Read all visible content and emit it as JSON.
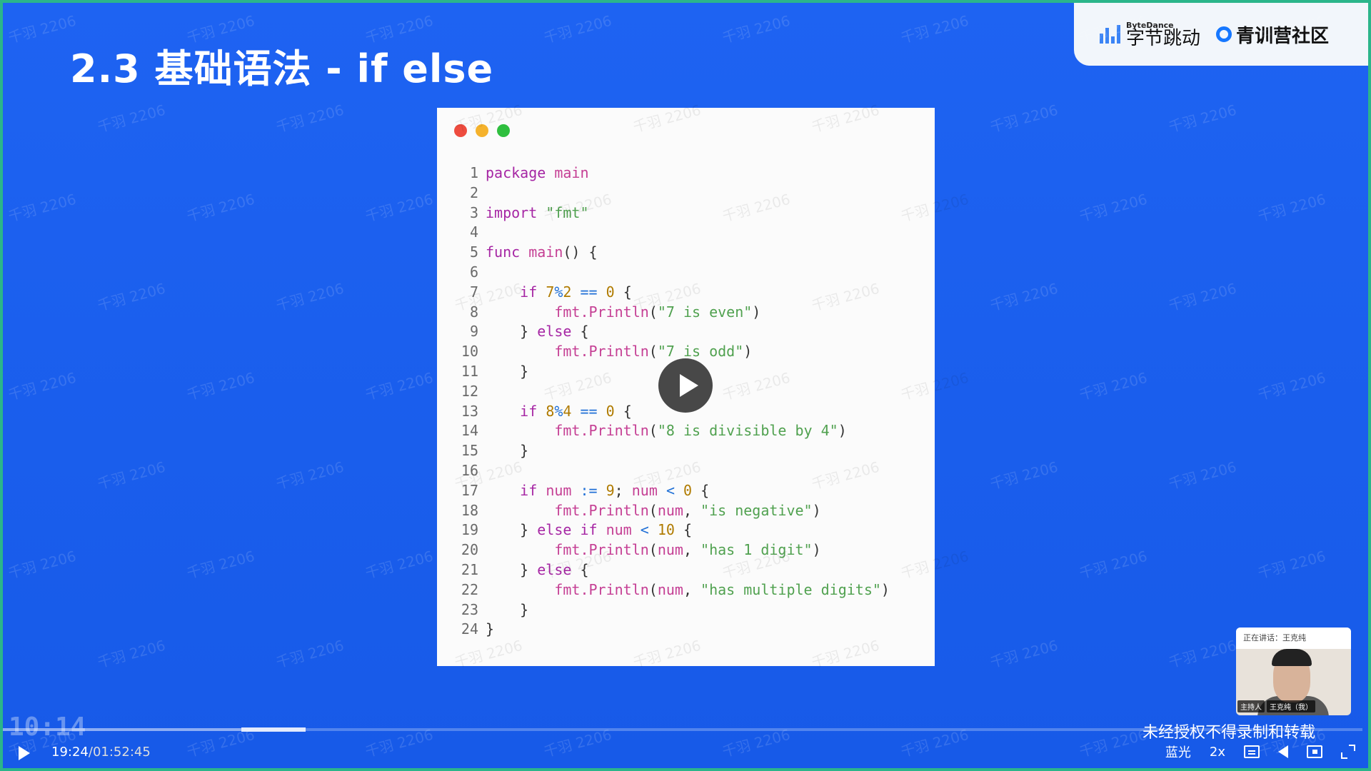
{
  "slide": {
    "title": "2.3 基础语法 - if else",
    "logo": {
      "small": "ByteDance",
      "big": "字节跳动",
      "community": "青训营社区"
    },
    "window_dots": [
      "#ee4c3f",
      "#f5b22c",
      "#2fbf3f"
    ]
  },
  "code": {
    "lines": [
      [
        [
          "kw",
          "package"
        ],
        [
          "pl",
          " "
        ],
        [
          "fn",
          "main"
        ]
      ],
      [],
      [
        [
          "kw",
          "import"
        ],
        [
          "pl",
          " "
        ],
        [
          "str",
          "\"fmt\""
        ]
      ],
      [],
      [
        [
          "kw",
          "func"
        ],
        [
          "pl",
          " "
        ],
        [
          "fn",
          "main"
        ],
        [
          "pl",
          "() {"
        ]
      ],
      [],
      [
        [
          "pl",
          "    "
        ],
        [
          "kw",
          "if"
        ],
        [
          "pl",
          " "
        ],
        [
          "num",
          "7"
        ],
        [
          "op",
          "%"
        ],
        [
          "num",
          "2"
        ],
        [
          "pl",
          " "
        ],
        [
          "op",
          "=="
        ],
        [
          "pl",
          " "
        ],
        [
          "num",
          "0"
        ],
        [
          "pl",
          " {"
        ]
      ],
      [
        [
          "pl",
          "        "
        ],
        [
          "fn",
          "fmt.Println"
        ],
        [
          "pl",
          "("
        ],
        [
          "str",
          "\"7 is even\""
        ],
        [
          "pl",
          ")"
        ]
      ],
      [
        [
          "pl",
          "    } "
        ],
        [
          "kw",
          "else"
        ],
        [
          "pl",
          " {"
        ]
      ],
      [
        [
          "pl",
          "        "
        ],
        [
          "fn",
          "fmt.Println"
        ],
        [
          "pl",
          "("
        ],
        [
          "str",
          "\"7 is odd\""
        ],
        [
          "pl",
          ")"
        ]
      ],
      [
        [
          "pl",
          "    }"
        ]
      ],
      [],
      [
        [
          "pl",
          "    "
        ],
        [
          "kw",
          "if"
        ],
        [
          "pl",
          " "
        ],
        [
          "num",
          "8"
        ],
        [
          "op",
          "%"
        ],
        [
          "num",
          "4"
        ],
        [
          "pl",
          " "
        ],
        [
          "op",
          "=="
        ],
        [
          "pl",
          " "
        ],
        [
          "num",
          "0"
        ],
        [
          "pl",
          " {"
        ]
      ],
      [
        [
          "pl",
          "        "
        ],
        [
          "fn",
          "fmt.Println"
        ],
        [
          "pl",
          "("
        ],
        [
          "str",
          "\"8 is divisible by 4\""
        ],
        [
          "pl",
          ")"
        ]
      ],
      [
        [
          "pl",
          "    }"
        ]
      ],
      [],
      [
        [
          "pl",
          "    "
        ],
        [
          "kw",
          "if"
        ],
        [
          "pl",
          " "
        ],
        [
          "fn",
          "num"
        ],
        [
          "pl",
          " "
        ],
        [
          "op",
          ":="
        ],
        [
          "pl",
          " "
        ],
        [
          "num",
          "9"
        ],
        [
          "pl",
          "; "
        ],
        [
          "fn",
          "num"
        ],
        [
          "pl",
          " "
        ],
        [
          "op",
          "<"
        ],
        [
          "pl",
          " "
        ],
        [
          "num",
          "0"
        ],
        [
          "pl",
          " {"
        ]
      ],
      [
        [
          "pl",
          "        "
        ],
        [
          "fn",
          "fmt.Println"
        ],
        [
          "pl",
          "("
        ],
        [
          "fn",
          "num"
        ],
        [
          "pl",
          ", "
        ],
        [
          "str",
          "\"is negative\""
        ],
        [
          "pl",
          ")"
        ]
      ],
      [
        [
          "pl",
          "    } "
        ],
        [
          "kw",
          "else if"
        ],
        [
          "pl",
          " "
        ],
        [
          "fn",
          "num"
        ],
        [
          "pl",
          " "
        ],
        [
          "op",
          "<"
        ],
        [
          "pl",
          " "
        ],
        [
          "num",
          "10"
        ],
        [
          "pl",
          " {"
        ]
      ],
      [
        [
          "pl",
          "        "
        ],
        [
          "fn",
          "fmt.Println"
        ],
        [
          "pl",
          "("
        ],
        [
          "fn",
          "num"
        ],
        [
          "pl",
          ", "
        ],
        [
          "str",
          "\"has 1 digit\""
        ],
        [
          "pl",
          ")"
        ]
      ],
      [
        [
          "pl",
          "    } "
        ],
        [
          "kw",
          "else"
        ],
        [
          "pl",
          " {"
        ]
      ],
      [
        [
          "pl",
          "        "
        ],
        [
          "fn",
          "fmt.Println"
        ],
        [
          "pl",
          "("
        ],
        [
          "fn",
          "num"
        ],
        [
          "pl",
          ", "
        ],
        [
          "str",
          "\"has multiple digits\""
        ],
        [
          "pl",
          ")"
        ]
      ],
      [
        [
          "pl",
          "    }"
        ]
      ],
      [
        [
          "pl",
          "}"
        ]
      ]
    ]
  },
  "watermark_text": "千羽 2206",
  "speaker": {
    "speaking": "正在讲话：王克纯",
    "role": "主持人",
    "name": "王克纯（我）"
  },
  "player": {
    "clock": "10:14",
    "notice": "未经授权不得录制和转载",
    "current_time": "19:24",
    "duration": "/01:52:45",
    "quality": "蓝光",
    "speed": "2x",
    "progress_fraction": 0.177
  }
}
